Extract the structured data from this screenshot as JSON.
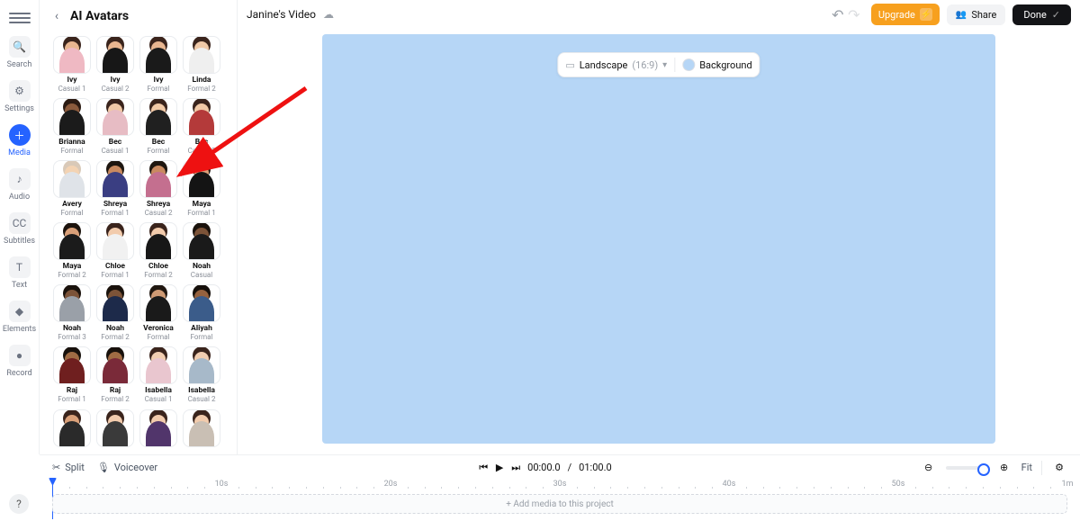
{
  "vnav": {
    "items": [
      {
        "label": "Search",
        "icon": "search-icon"
      },
      {
        "label": "Settings",
        "icon": "adjust-icon"
      },
      {
        "label": "Media",
        "icon": "plus-icon",
        "active": true
      },
      {
        "label": "Audio",
        "icon": "music-icon"
      },
      {
        "label": "Subtitles",
        "icon": "cc-icon"
      },
      {
        "label": "Text",
        "icon": "text-icon"
      },
      {
        "label": "Elements",
        "icon": "shapes-icon"
      },
      {
        "label": "Record",
        "icon": "record-icon"
      }
    ]
  },
  "panel": {
    "title": "AI Avatars",
    "avatars": [
      {
        "name": "Ivy",
        "variant": "Casual 1",
        "hair": "#3a241c",
        "torso": "#efb9c3",
        "skin": "#e9b690"
      },
      {
        "name": "Ivy",
        "variant": "Casual 2",
        "hair": "#3a241c",
        "torso": "#171717",
        "skin": "#e9b690"
      },
      {
        "name": "Ivy",
        "variant": "Formal",
        "hair": "#3a241c",
        "torso": "#1a1a1a",
        "skin": "#e9b690"
      },
      {
        "name": "Linda",
        "variant": "Formal 2",
        "hair": "#3a241c",
        "torso": "#efefef",
        "skin": "#f0c9a8"
      },
      {
        "name": "Brianna",
        "variant": "Formal",
        "hair": "#2b1a12",
        "torso": "#1b1b1b",
        "skin": "#8b5a3c"
      },
      {
        "name": "Bec",
        "variant": "Casual 1",
        "hair": "#3a241c",
        "torso": "#e7bcc4",
        "skin": "#f1c9a6"
      },
      {
        "name": "Bec",
        "variant": "Formal",
        "hair": "#3a241c",
        "torso": "#202020",
        "skin": "#f1c9a6"
      },
      {
        "name": "Bec",
        "variant": "Casual 2",
        "hair": "#3a241c",
        "torso": "#b43a3a",
        "skin": "#f1c9a6"
      },
      {
        "name": "Avery",
        "variant": "Formal",
        "hair": "#d9c9b8",
        "torso": "#dfe3e8",
        "skin": "#f3d3b3"
      },
      {
        "name": "Shreya",
        "variant": "Formal 1",
        "hair": "#1d1610",
        "torso": "#3a3e82",
        "skin": "#c98a60"
      },
      {
        "name": "Shreya",
        "variant": "Casual 2",
        "hair": "#1d1610",
        "torso": "#c46f8f",
        "skin": "#c98a60"
      },
      {
        "name": "Maya",
        "variant": "Formal 1",
        "hair": "#1c130d",
        "torso": "#141414",
        "skin": "#d9a079"
      },
      {
        "name": "Maya",
        "variant": "Formal 2",
        "hair": "#1c130d",
        "torso": "#1b1b1b",
        "skin": "#d9a079"
      },
      {
        "name": "Chloe",
        "variant": "Formal 1",
        "hair": "#3a241c",
        "torso": "#f1f1f1",
        "skin": "#f2cbac"
      },
      {
        "name": "Chloe",
        "variant": "Formal 2",
        "hair": "#3a241c",
        "torso": "#171717",
        "skin": "#f2cbac"
      },
      {
        "name": "Noah",
        "variant": "Casual",
        "hair": "#1a120c",
        "torso": "#1a1a1a",
        "skin": "#7c5338"
      },
      {
        "name": "Noah",
        "variant": "Formal 3",
        "hair": "#1a120c",
        "torso": "#9aa0a8",
        "skin": "#7c5338"
      },
      {
        "name": "Noah",
        "variant": "Formal 2",
        "hair": "#1a120c",
        "torso": "#1d2a4a",
        "skin": "#7c5338"
      },
      {
        "name": "Veronica",
        "variant": "Formal",
        "hair": "#201710",
        "torso": "#1a1a1a",
        "skin": "#ce9a74"
      },
      {
        "name": "Aliyah",
        "variant": "Formal",
        "hair": "#16100b",
        "torso": "#3b5c8a",
        "skin": "#96623e"
      },
      {
        "name": "Raj",
        "variant": "Formal 1",
        "hair": "#18110c",
        "torso": "#6f1f1f",
        "skin": "#a06c44"
      },
      {
        "name": "Raj",
        "variant": "Formal 2",
        "hair": "#18110c",
        "torso": "#7a2a39",
        "skin": "#a06c44"
      },
      {
        "name": "Isabella",
        "variant": "Casual 1",
        "hair": "#3a241c",
        "torso": "#e9c6cf",
        "skin": "#f1cdb0"
      },
      {
        "name": "Isabella",
        "variant": "Casual 2",
        "hair": "#3a241c",
        "torso": "#a7b9c9",
        "skin": "#f1cdb0"
      },
      {
        "name": "—",
        "variant": "",
        "hair": "#3a241c",
        "torso": "#2a2a2a",
        "skin": "#d9a079"
      },
      {
        "name": "—",
        "variant": "",
        "hair": "#3a241c",
        "torso": "#3a3a3a",
        "skin": "#f2cbac"
      },
      {
        "name": "—",
        "variant": "",
        "hair": "#3a241c",
        "torso": "#51356b",
        "skin": "#f2cbac"
      },
      {
        "name": "—",
        "variant": "",
        "hair": "#3a241c",
        "torso": "#c9bfb4",
        "skin": "#f2cbac"
      }
    ]
  },
  "header": {
    "title": "Janine's Video",
    "upgrade": "Upgrade",
    "share": "Share",
    "done": "Done"
  },
  "canvas": {
    "aspect_label": "Landscape",
    "aspect_value": "(16:9)",
    "background_label": "Background",
    "background_color": "#b6d6f6"
  },
  "toolbar": {
    "split": "Split",
    "voiceover": "Voiceover",
    "time_current": "00:00.0",
    "time_total": "01:00.0",
    "fit": "Fit"
  },
  "timeline": {
    "ticks": [
      "10s",
      "20s",
      "30s",
      "40s",
      "50s",
      "1m"
    ],
    "track_placeholder": "+  Add media to this project"
  }
}
